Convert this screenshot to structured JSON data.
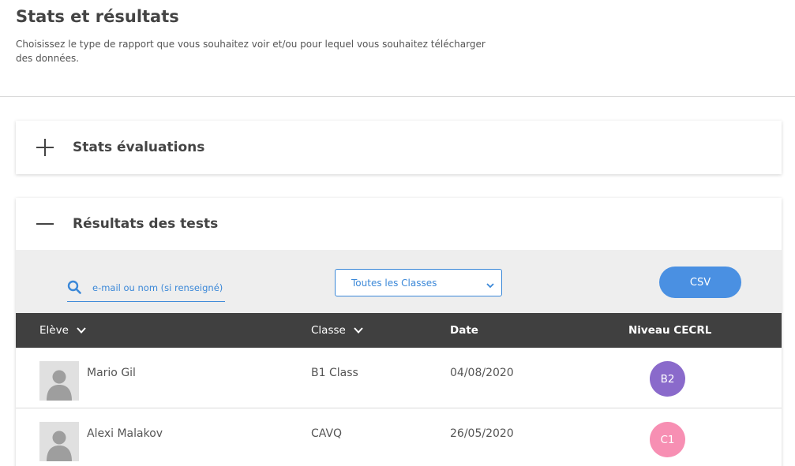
{
  "page": {
    "title": "Stats et résultats",
    "description": "Choisissez le type de rapport que vous souhaitez voir et/ou pour lequel vous souhaitez télécharger des données."
  },
  "panels": {
    "stats": {
      "title": "Stats évaluations",
      "icon": "plus-icon"
    },
    "results": {
      "title": "Résultats des tests",
      "icon": "minus-icon"
    }
  },
  "toolbar": {
    "search_placeholder": "e-mail ou nom (si renseigné)",
    "class_select_value": "Toutes les Classes",
    "csv_label": "CSV"
  },
  "table": {
    "headers": {
      "student": "Elève",
      "class": "Classe",
      "date": "Date",
      "level": "Niveau CECRL"
    },
    "rows": [
      {
        "name": "Mario Gil",
        "class": "B1 Class",
        "date": "04/08/2020",
        "level": "B2",
        "level_color": "#8a6acb"
      },
      {
        "name": "Alexi Malakov",
        "class": "CAVQ",
        "date": "26/05/2020",
        "level": "C1",
        "level_color": "#f78fb3"
      }
    ]
  },
  "colors": {
    "accent": "#4a90e2",
    "table_header_bg": "#404040",
    "toolbar_bg": "#eeeeee"
  }
}
